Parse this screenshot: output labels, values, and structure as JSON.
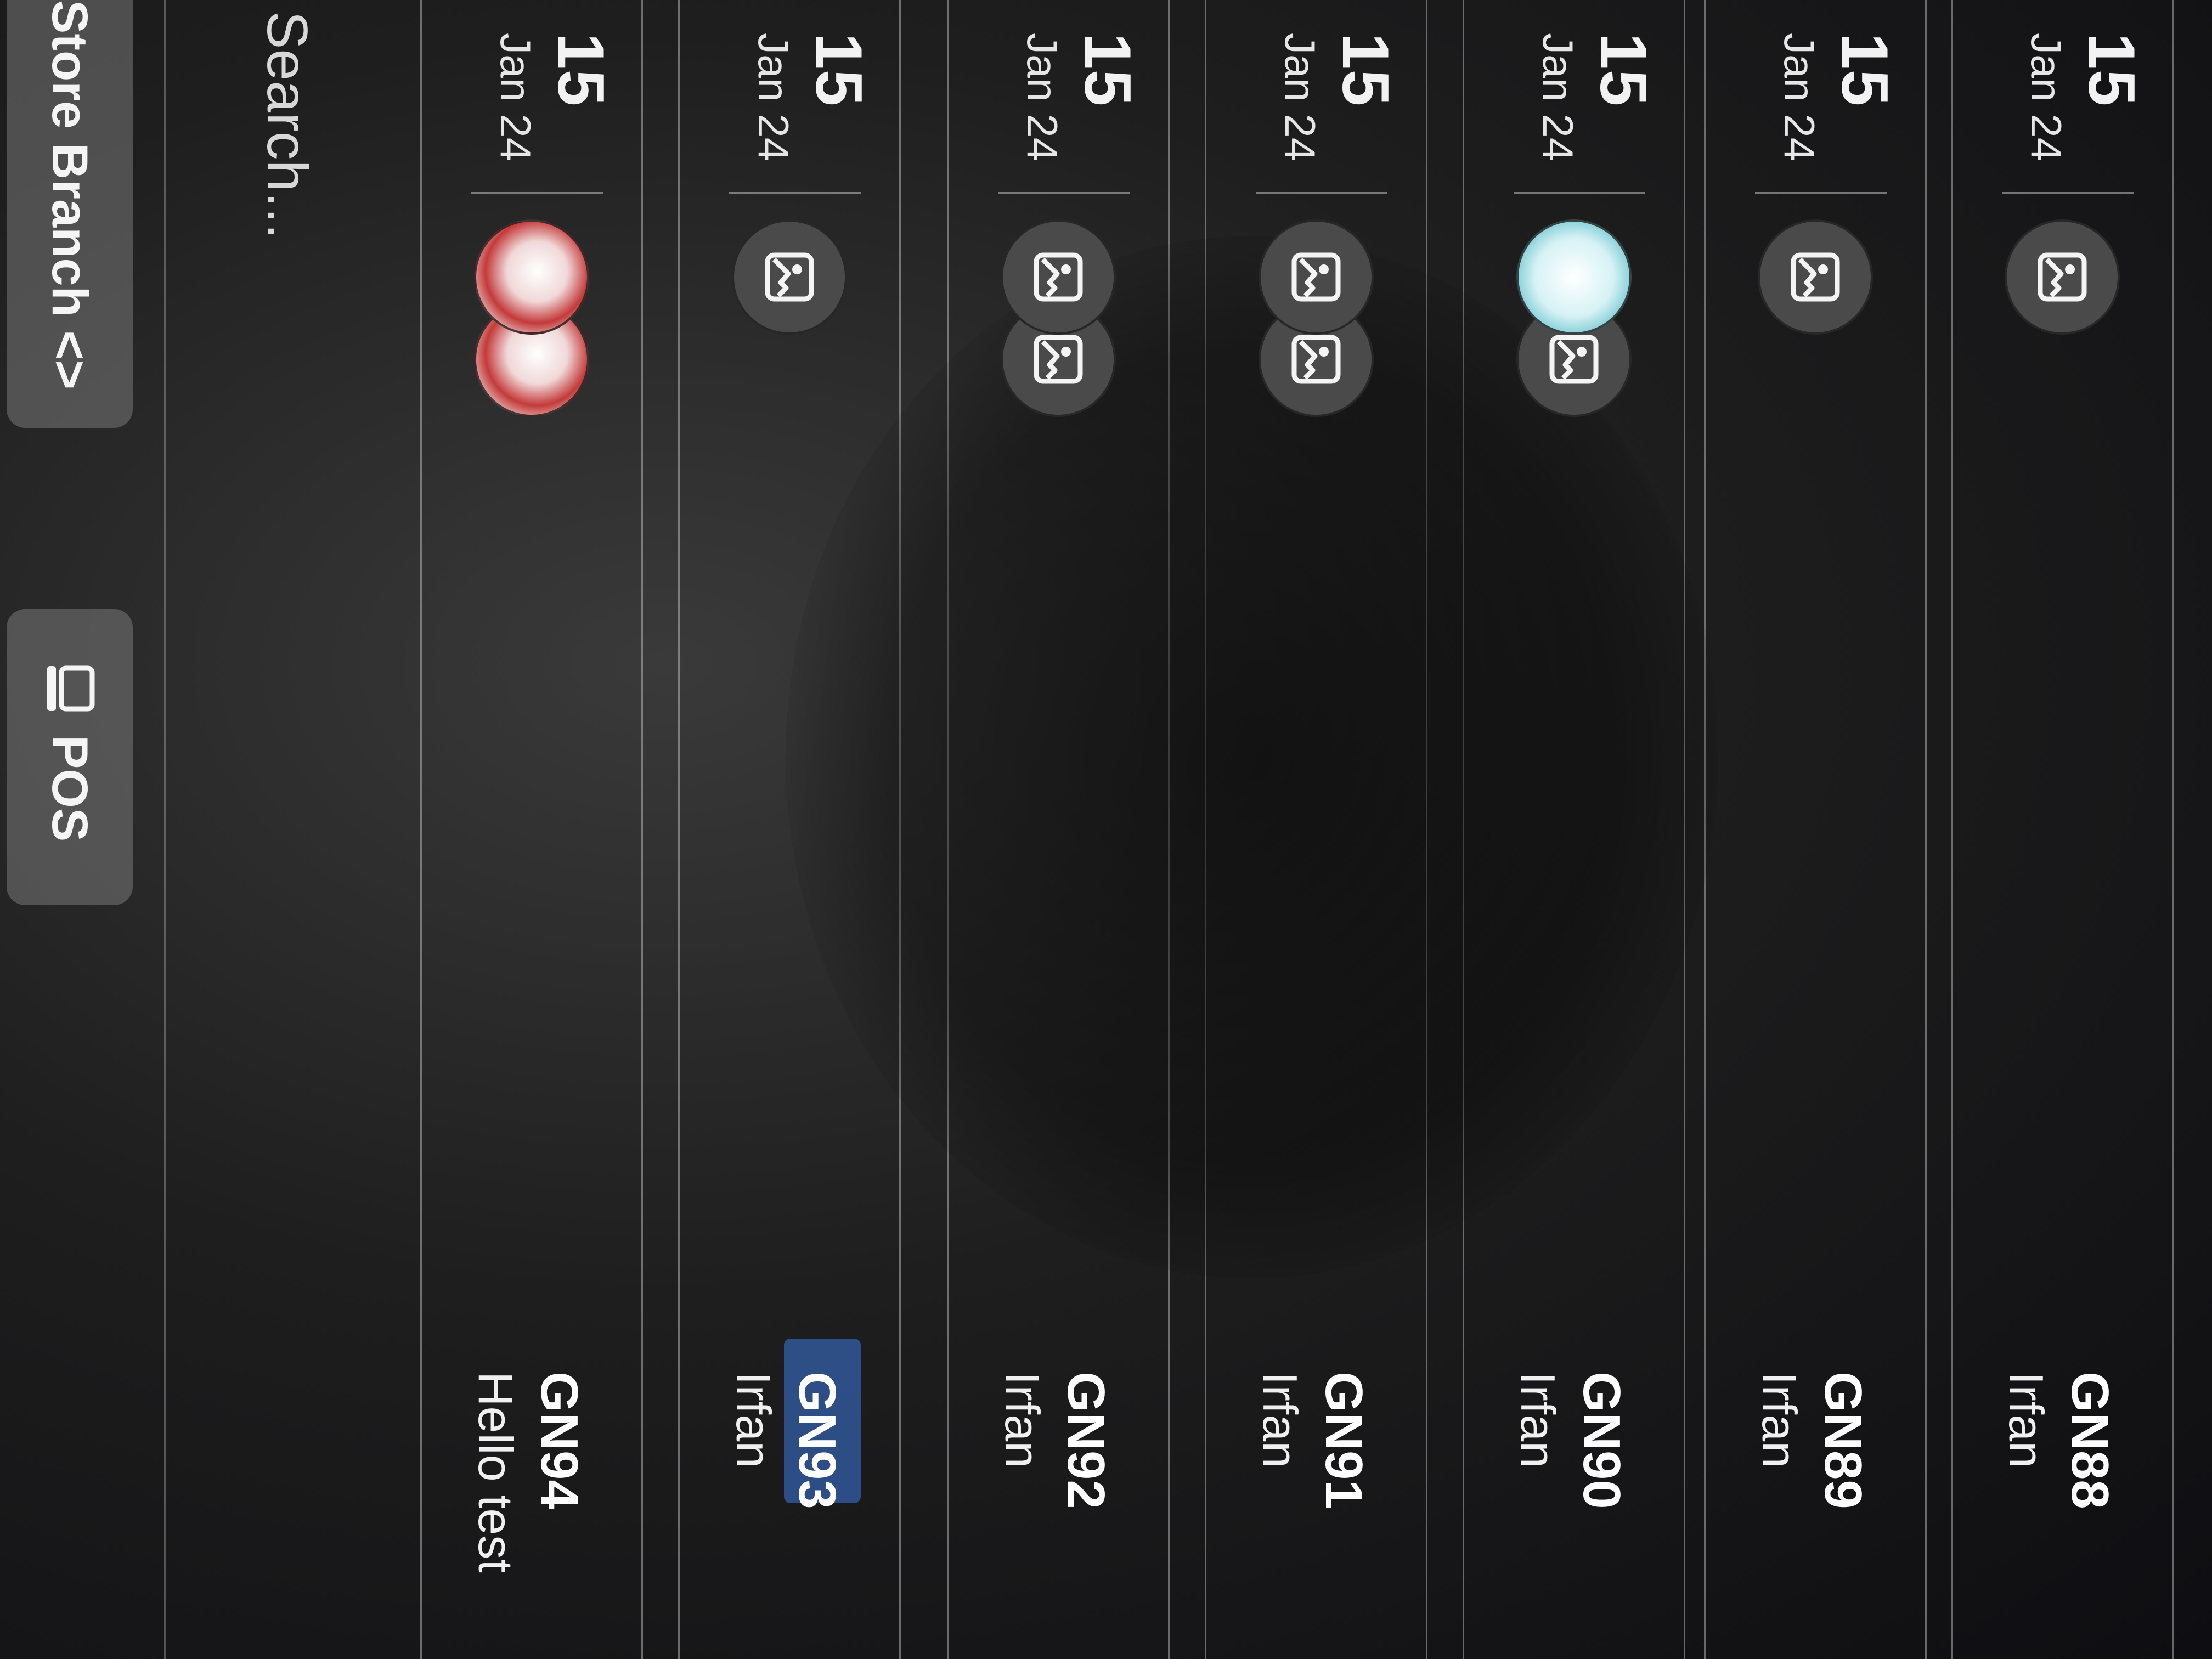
{
  "header": {
    "branch_label": "Store Branch",
    "branch_chevron": "<>",
    "pos_label": "POS",
    "pos_icon": "pos-terminal-icon"
  },
  "search": {
    "placeholder": "Search..."
  },
  "orders": [
    {
      "id": "GN94",
      "customer": "Hello test",
      "day": "15",
      "month": "Jan 24",
      "thumbs": [
        "photo",
        "photo"
      ]
    },
    {
      "id": "GN93",
      "customer": "Irfan",
      "day": "15",
      "month": "Jan 24",
      "thumbs": [
        "image-placeholder"
      ],
      "selected": true
    },
    {
      "id": "GN92",
      "customer": "Irfan",
      "day": "15",
      "month": "Jan 24",
      "thumbs": [
        "image-placeholder",
        "image-placeholder"
      ]
    },
    {
      "id": "GN91",
      "customer": "Irfan",
      "day": "15",
      "month": "Jan 24",
      "thumbs": [
        "image-placeholder",
        "image-placeholder"
      ]
    },
    {
      "id": "GN90",
      "customer": "Irfan",
      "day": "15",
      "month": "Jan 24",
      "thumbs": [
        "photo-cyan",
        "image-placeholder"
      ]
    },
    {
      "id": "GN89",
      "customer": "Irfan",
      "day": "15",
      "month": "Jan 24",
      "thumbs": [
        "image-placeholder"
      ]
    },
    {
      "id": "GN88",
      "customer": "Irfan",
      "day": "15",
      "month": "Jan 24",
      "thumbs": [
        "image-placeholder"
      ]
    }
  ],
  "colors": {
    "background": "#161616",
    "pill": "#7a7a7a",
    "text": "#f2f2f2",
    "selection": "#3c78dc"
  }
}
